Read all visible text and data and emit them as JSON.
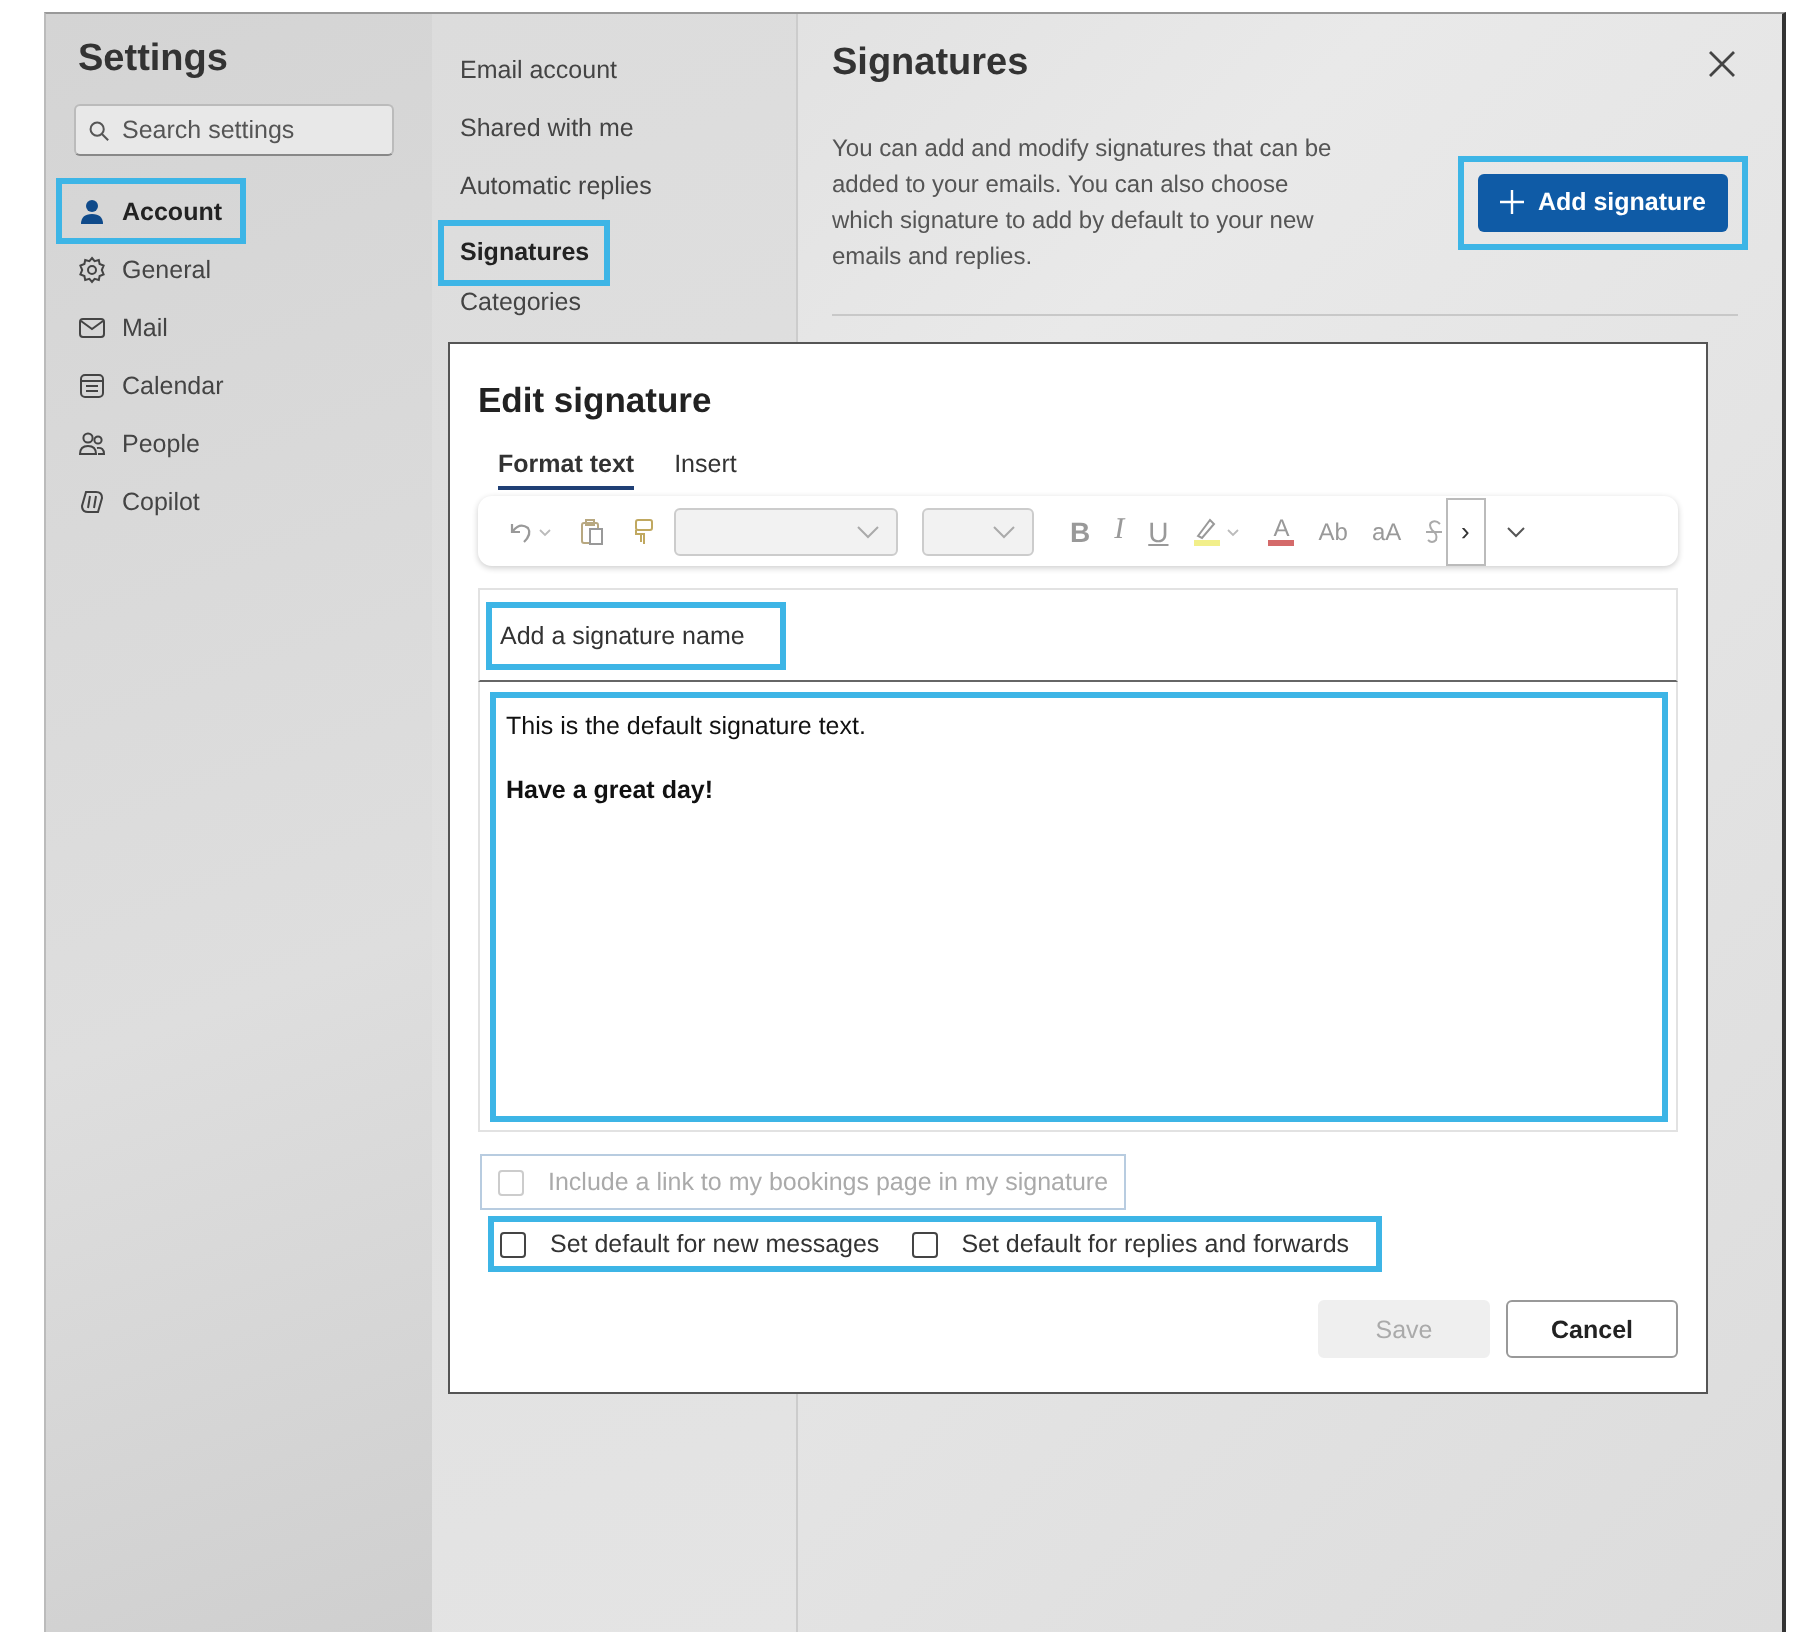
{
  "settings": {
    "title": "Settings",
    "search": {
      "placeholder": "Search settings"
    },
    "nav": [
      {
        "label": "Account",
        "selected": true,
        "highlighted": true
      },
      {
        "label": "General",
        "selected": false,
        "highlighted": false
      },
      {
        "label": "Mail",
        "selected": false,
        "highlighted": false
      },
      {
        "label": "Calendar",
        "selected": false,
        "highlighted": false
      },
      {
        "label": "People",
        "selected": false,
        "highlighted": false
      },
      {
        "label": "Copilot",
        "selected": false,
        "highlighted": false
      }
    ]
  },
  "subnav": [
    {
      "label": "Email account",
      "selected": false,
      "highlighted": false
    },
    {
      "label": "Shared with me",
      "selected": false,
      "highlighted": false
    },
    {
      "label": "Automatic replies",
      "selected": false,
      "highlighted": false
    },
    {
      "label": "Signatures",
      "selected": true,
      "highlighted": true
    },
    {
      "label": "Categories",
      "selected": false,
      "highlighted": false
    }
  ],
  "pane": {
    "title": "Signatures",
    "description": "You can add and modify signatures that can be added to your emails. You can also choose which signature to add by default to your new emails and replies.",
    "add_button": {
      "label": "Add signature",
      "highlighted": true
    }
  },
  "dialog": {
    "title": "Edit signature",
    "tabs": [
      {
        "label": "Format text",
        "selected": true
      },
      {
        "label": "Insert",
        "selected": false
      }
    ],
    "toolbar": [
      {
        "kind": "undo"
      },
      {
        "kind": "paste"
      },
      {
        "kind": "painter"
      },
      {
        "kind": "font"
      },
      {
        "kind": "size"
      },
      {
        "kind": "bold",
        "label": "B"
      },
      {
        "kind": "italic",
        "label": "I"
      },
      {
        "kind": "underline",
        "label": "U"
      },
      {
        "kind": "highlight"
      },
      {
        "kind": "color",
        "label": "A"
      },
      {
        "kind": "spelling",
        "label": "Ab"
      },
      {
        "kind": "case",
        "label": "aA"
      },
      {
        "kind": "strike"
      },
      {
        "kind": "more",
        "label": "›"
      }
    ],
    "name_field": {
      "placeholder": "Add a signature name",
      "highlighted": true
    },
    "body": {
      "highlighted": true,
      "lines": [
        {
          "text": "This is the default signature text.",
          "bold": false
        },
        {
          "text": "Have a great day!",
          "bold": true
        }
      ]
    },
    "bookings": {
      "label": "Include a link to my bookings page in my signature",
      "checked": false,
      "disabled": true
    },
    "defaults": {
      "highlighted": true,
      "options": [
        {
          "label": "Set default for new messages",
          "checked": false
        },
        {
          "label": "Set default for replies and forwards",
          "checked": false
        }
      ]
    },
    "buttons": [
      {
        "label": "Save",
        "disabled": true
      },
      {
        "label": "Cancel",
        "disabled": false
      }
    ]
  }
}
